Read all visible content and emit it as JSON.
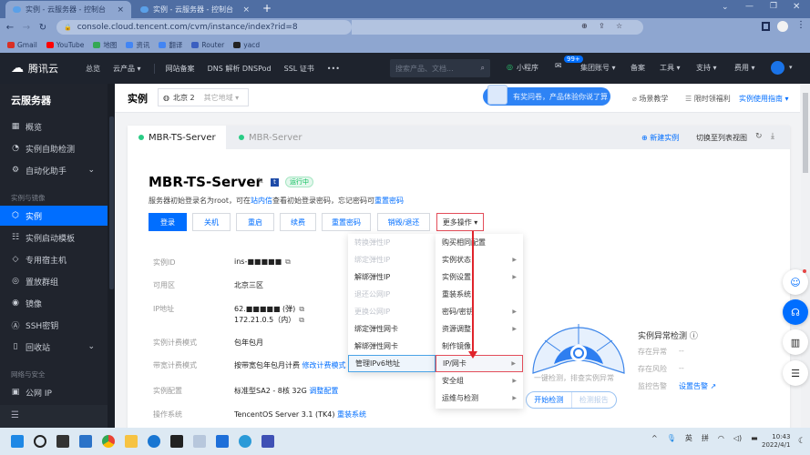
{
  "browser": {
    "tabs": [
      {
        "label": "实例 - 云服务器 - 控制台",
        "active": true
      },
      {
        "label": "实例 - 云服务器 - 控制台",
        "active": false
      }
    ],
    "new_tab": "+",
    "url": "console.cloud.tencent.com/cvm/instance/index?rid=8",
    "bookmarks": [
      {
        "label": "Gmail",
        "color": "#d93025"
      },
      {
        "label": "YouTube",
        "color": "#ff0000"
      },
      {
        "label": "地图",
        "color": "#34a853"
      },
      {
        "label": "资讯",
        "color": "#4285f4"
      },
      {
        "label": "翻译",
        "color": "#4285f4"
      },
      {
        "label": "Router",
        "color": "#3b5fc0"
      },
      {
        "label": "yacd",
        "color": "#222"
      }
    ]
  },
  "topnav": {
    "brand": "腾讯云",
    "items": [
      "总览",
      "云产品 ▾",
      "网站备案",
      "DNS 解析 DNSPod",
      "SSL 证书",
      "•••"
    ],
    "search_placeholder": "搜索产品、文档...",
    "right": [
      "小程序",
      "集团账号 ▾",
      "备案",
      "工具 ▾",
      "支持 ▾",
      "费用 ▾"
    ],
    "badge": "99+"
  },
  "sidebar": {
    "title": "云服务器",
    "items": [
      {
        "label": "概览",
        "icon": "grid-icon"
      },
      {
        "label": "实例自助检测",
        "icon": "gauge-icon"
      },
      {
        "label": "自动化助手",
        "icon": "robot-icon",
        "expand": "⌄"
      },
      {
        "label": "实例",
        "icon": "instance-icon",
        "active": true
      },
      {
        "label": "实例启动模板",
        "icon": "template-icon"
      },
      {
        "label": "专用宿主机",
        "icon": "host-icon"
      },
      {
        "label": "置放群组",
        "icon": "group-icon"
      },
      {
        "label": "镜像",
        "icon": "image-icon"
      },
      {
        "label": "SSH密钥",
        "icon": "key-icon"
      },
      {
        "label": "回收站",
        "icon": "trash-icon",
        "expand": "⌄"
      },
      {
        "label": "公网 IP",
        "icon": "ip-icon"
      }
    ],
    "groups": [
      "实例与镜像",
      "网络与安全"
    ]
  },
  "header": {
    "title": "实例",
    "region": "北京 2",
    "region_other": "其它地域 ▾",
    "banner": "有奖问卷，产品体验你说了算",
    "links": [
      "场景教学",
      "限时领福利",
      "实例使用指南 ▾"
    ]
  },
  "instance_tabs": [
    {
      "label": "MBR-TS-Server",
      "active": true
    },
    {
      "label": "MBR-Server",
      "active": false
    }
  ],
  "toolbar": {
    "new": "新建实例",
    "switch": "切换至列表视图"
  },
  "instance": {
    "name": "MBR-TS-Server",
    "status": "运行中",
    "hint_pre": "服务器初始登录名为root，可在",
    "hint_link1": "站内信",
    "hint_mid": "查看初始登录密码，忘记密码可",
    "hint_link2": "重置密码",
    "buttons": [
      "登录",
      "关机",
      "重启",
      "续费",
      "重置密码",
      "销毁/退还",
      "更多操作 ▾"
    ],
    "fields": [
      {
        "label": "实例ID",
        "value": "ins-■■■■■"
      },
      {
        "label": "可用区",
        "value": "北京三区"
      },
      {
        "label": "IP地址",
        "value": "62.■■■■■ (弹)"
      },
      {
        "label": "",
        "value": "172.21.0.5（内）"
      },
      {
        "label": "实例计费模式",
        "value": "包年包月"
      },
      {
        "label": "带宽计费模式",
        "value": "按带宽包年包月计费",
        "link": "修改计费模式"
      },
      {
        "label": "实例配置",
        "value": "标准型SA2 - 8核 32G",
        "link": "调整配置"
      },
      {
        "label": "操作系统",
        "value": "TencentOS Server 3.1 (TK4)",
        "link": "重装系统"
      }
    ]
  },
  "more_menu": [
    {
      "label": "购买相同配置",
      "arrow": false
    },
    {
      "label": "实例状态",
      "arrow": true
    },
    {
      "label": "实例设置",
      "arrow": true
    },
    {
      "label": "重装系统",
      "arrow": false
    },
    {
      "label": "密码/密钥",
      "arrow": true
    },
    {
      "label": "资源调整",
      "arrow": true
    },
    {
      "label": "制作镜像",
      "arrow": false
    },
    {
      "label": "IP/网卡",
      "arrow": true,
      "highlight": true
    },
    {
      "label": "安全组",
      "arrow": true
    },
    {
      "label": "运维与检测",
      "arrow": true
    }
  ],
  "ip_submenu": [
    {
      "label": "转换弹性IP",
      "disabled": true
    },
    {
      "label": "绑定弹性IP",
      "disabled": true
    },
    {
      "label": "解绑弹性IP",
      "disabled": false
    },
    {
      "label": "退还公网IP",
      "disabled": true
    },
    {
      "label": "更换公网IP",
      "disabled": true
    },
    {
      "label": "绑定弹性网卡",
      "disabled": false
    },
    {
      "label": "解绑弹性网卡",
      "disabled": false
    },
    {
      "label": "管理IPv6地址",
      "disabled": false,
      "highlight": true
    }
  ],
  "detection": {
    "caption": "一键检测，排查实例异常",
    "start": "开始检测",
    "report": "检测报告",
    "title": "实例异常检测 ⓘ",
    "rows": [
      {
        "label": "存在异常",
        "value": "--"
      },
      {
        "label": "存在风险",
        "value": "--"
      },
      {
        "label": "监控告警",
        "value": "设置告警 ↗"
      }
    ]
  },
  "taskbar": {
    "tray": [
      "^",
      "英",
      "拼"
    ],
    "time": "10:43",
    "date": "2022/4/1"
  }
}
